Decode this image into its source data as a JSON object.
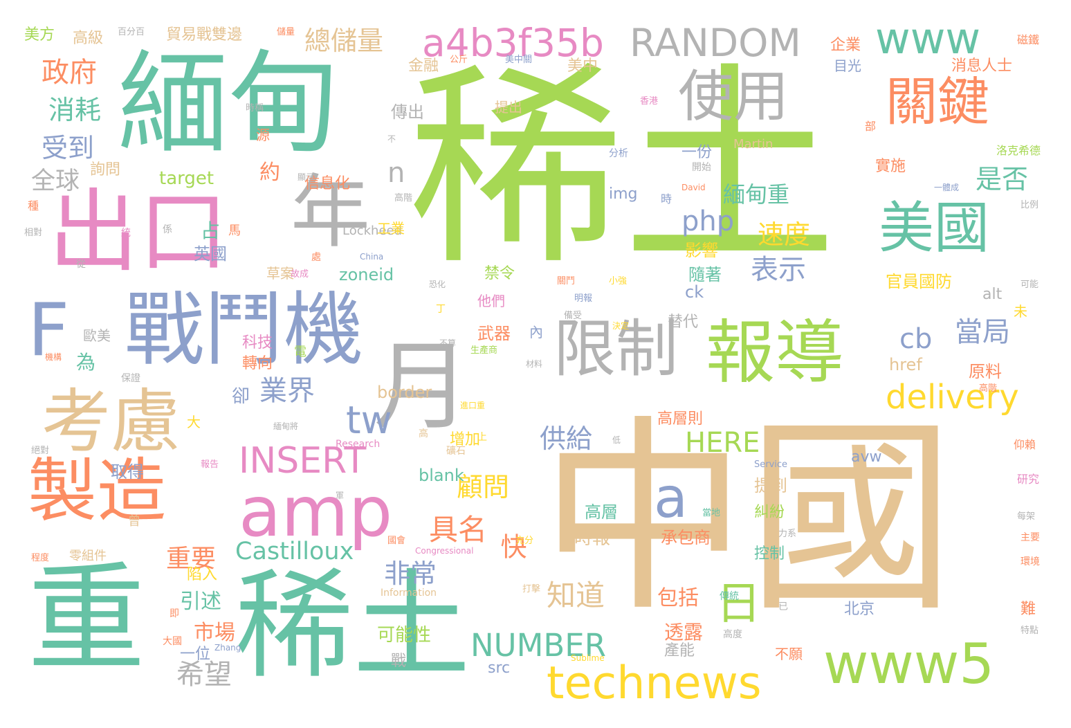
{
  "palette": {
    "green": "#a6d854",
    "teal": "#66c2a5",
    "orange": "#fc8d62",
    "blue": "#8da0cb",
    "pink": "#e78ac3",
    "tan": "#e5c494",
    "yellow": "#ffd92f",
    "gray": "#b3b3b3"
  },
  "words": [
    {
      "text": "稀土",
      "color": "green"
    },
    {
      "text": "中國",
      "color": "tan"
    },
    {
      "text": "緬甸",
      "color": "teal"
    },
    {
      "text": "稀土",
      "color": "teal"
    },
    {
      "text": "重",
      "color": "teal"
    },
    {
      "text": "出口",
      "color": "pink"
    },
    {
      "text": "戰鬥機",
      "color": "blue"
    },
    {
      "text": "F",
      "color": "blue"
    },
    {
      "text": "月",
      "color": "gray"
    },
    {
      "text": "年",
      "color": "gray"
    },
    {
      "text": "考慮",
      "color": "tan"
    },
    {
      "text": "製造",
      "color": "orange"
    },
    {
      "text": "amp",
      "color": "pink"
    },
    {
      "text": "報導",
      "color": "green"
    },
    {
      "text": "限制",
      "color": "gray"
    },
    {
      "text": "使用",
      "color": "gray"
    },
    {
      "text": "關鍵",
      "color": "orange"
    },
    {
      "text": "美國",
      "color": "teal"
    },
    {
      "text": "www",
      "color": "teal"
    },
    {
      "text": "www5",
      "color": "green"
    },
    {
      "text": "technews",
      "color": "yellow"
    },
    {
      "text": "RANDOM",
      "color": "gray"
    },
    {
      "text": "a4b3f35b",
      "color": "pink"
    },
    {
      "text": "delivery",
      "color": "yellow"
    },
    {
      "text": "INSERT",
      "color": "pink"
    },
    {
      "text": "NUMBER",
      "color": "teal"
    },
    {
      "text": "Castilloux",
      "color": "teal"
    },
    {
      "text": "HERE",
      "color": "green"
    },
    {
      "text": "php",
      "color": "blue"
    },
    {
      "text": "tw",
      "color": "blue"
    },
    {
      "text": "cb",
      "color": "blue"
    },
    {
      "text": "a",
      "color": "blue"
    },
    {
      "text": "n",
      "color": "gray"
    },
    {
      "text": "日",
      "color": "green"
    },
    {
      "text": "政府",
      "color": "orange"
    },
    {
      "text": "消耗",
      "color": "teal"
    },
    {
      "text": "受到",
      "color": "blue"
    },
    {
      "text": "全球",
      "color": "gray"
    },
    {
      "text": "總儲量",
      "color": "tan"
    },
    {
      "text": "當局",
      "color": "blue"
    },
    {
      "text": "是否",
      "color": "teal"
    },
    {
      "text": "表示",
      "color": "blue"
    },
    {
      "text": "速度",
      "color": "yellow"
    },
    {
      "text": "緬甸重",
      "color": "teal"
    },
    {
      "text": "業界",
      "color": "blue"
    },
    {
      "text": "供給",
      "color": "blue"
    },
    {
      "text": "具名",
      "color": "orange"
    },
    {
      "text": "顧問",
      "color": "yellow"
    },
    {
      "text": "非常",
      "color": "blue"
    },
    {
      "text": "知道",
      "color": "tan"
    },
    {
      "text": "希望",
      "color": "gray"
    },
    {
      "text": "重要",
      "color": "orange"
    },
    {
      "text": "市場",
      "color": "orange"
    },
    {
      "text": "引述",
      "color": "teal"
    },
    {
      "text": "陷入",
      "color": "yellow"
    },
    {
      "text": "一位",
      "color": "blue"
    },
    {
      "text": "包括",
      "color": "orange"
    },
    {
      "text": "透露",
      "color": "orange"
    },
    {
      "text": "產能",
      "color": "gray"
    },
    {
      "text": "承包商",
      "color": "orange"
    },
    {
      "text": "時報",
      "color": "tan"
    },
    {
      "text": "高層",
      "color": "teal"
    },
    {
      "text": "高層則",
      "color": "orange"
    },
    {
      "text": "增加",
      "color": "yellow"
    },
    {
      "text": "取得",
      "color": "blue"
    },
    {
      "text": "提到",
      "color": "tan"
    },
    {
      "text": "糾紛",
      "color": "green"
    },
    {
      "text": "控制",
      "color": "teal"
    },
    {
      "text": "北京",
      "color": "blue"
    },
    {
      "text": "可能性",
      "color": "green"
    },
    {
      "text": "src",
      "color": "blue"
    },
    {
      "text": "blank",
      "color": "teal"
    },
    {
      "text": "avw",
      "color": "blue"
    },
    {
      "text": "border",
      "color": "tan"
    },
    {
      "text": "href",
      "color": "tan"
    },
    {
      "text": "zoneid",
      "color": "teal"
    },
    {
      "text": "ck",
      "color": "blue"
    },
    {
      "text": "img",
      "color": "blue"
    },
    {
      "text": "target",
      "color": "green"
    },
    {
      "text": "alt",
      "color": "gray"
    },
    {
      "text": "Martin",
      "color": "tan"
    },
    {
      "text": "Lockheed",
      "color": "gray"
    },
    {
      "text": "Research",
      "color": "pink"
    },
    {
      "text": "Information",
      "color": "tan"
    },
    {
      "text": "Service",
      "color": "blue"
    },
    {
      "text": "Sublime",
      "color": "yellow"
    },
    {
      "text": "Zhang",
      "color": "blue"
    },
    {
      "text": "David",
      "color": "orange"
    },
    {
      "text": "China",
      "color": "blue"
    },
    {
      "text": "Congressional",
      "color": "pink"
    },
    {
      "text": "英國",
      "color": "blue"
    },
    {
      "text": "占",
      "color": "teal"
    },
    {
      "text": "馬",
      "color": "orange"
    },
    {
      "text": "武器",
      "color": "orange"
    },
    {
      "text": "禁令",
      "color": "green"
    },
    {
      "text": "他們",
      "color": "pink"
    },
    {
      "text": "科技",
      "color": "pink"
    },
    {
      "text": "轉向",
      "color": "orange"
    },
    {
      "text": "為",
      "color": "teal"
    },
    {
      "text": "卻",
      "color": "blue"
    },
    {
      "text": "快",
      "color": "orange"
    },
    {
      "text": "約",
      "color": "orange"
    },
    {
      "text": "草案",
      "color": "tan"
    },
    {
      "text": "影響",
      "color": "yellow"
    },
    {
      "text": "隨著",
      "color": "teal"
    },
    {
      "text": "替代",
      "color": "gray"
    },
    {
      "text": "傳出",
      "color": "gray"
    },
    {
      "text": "提出",
      "color": "tan"
    },
    {
      "text": "目光",
      "color": "blue"
    },
    {
      "text": "美中",
      "color": "tan"
    },
    {
      "text": "金融",
      "color": "tan"
    },
    {
      "text": "企業",
      "color": "orange"
    },
    {
      "text": "消息人士",
      "color": "orange"
    },
    {
      "text": "官員國防",
      "color": "yellow"
    },
    {
      "text": "實施",
      "color": "orange"
    },
    {
      "text": "原料",
      "color": "orange"
    },
    {
      "text": "工業",
      "color": "yellow"
    },
    {
      "text": "信息化",
      "color": "orange"
    },
    {
      "text": "詢問",
      "color": "tan"
    },
    {
      "text": "歐美",
      "color": "gray"
    },
    {
      "text": "美方",
      "color": "green"
    },
    {
      "text": "高級",
      "color": "tan"
    },
    {
      "text": "貿易戰雙邊",
      "color": "tan"
    },
    {
      "text": "百分百",
      "color": "gray"
    },
    {
      "text": "儲量",
      "color": "orange"
    },
    {
      "text": "磁鐵",
      "color": "orange"
    },
    {
      "text": "洛克希德",
      "color": "green"
    },
    {
      "text": "一份",
      "color": "blue"
    },
    {
      "text": "部",
      "color": "orange"
    },
    {
      "text": "時",
      "color": "blue"
    },
    {
      "text": "無法",
      "color": "green"
    },
    {
      "text": "開始",
      "color": "gray"
    },
    {
      "text": "比例",
      "color": "gray"
    },
    {
      "text": "一體成",
      "color": "blue"
    },
    {
      "text": "分析",
      "color": "blue"
    },
    {
      "text": "香港",
      "color": "pink"
    },
    {
      "text": "美中關",
      "color": "blue"
    },
    {
      "text": "公斤",
      "color": "orange"
    },
    {
      "text": "戰",
      "color": "gray"
    },
    {
      "text": "不願",
      "color": "orange"
    },
    {
      "text": "難",
      "color": "orange"
    },
    {
      "text": "未",
      "color": "yellow"
    },
    {
      "text": "內",
      "color": "blue"
    },
    {
      "text": "源",
      "color": "orange"
    },
    {
      "text": "不",
      "color": "gray"
    },
    {
      "text": "顯示",
      "color": "gray"
    },
    {
      "text": "高階",
      "color": "gray"
    },
    {
      "text": "種",
      "color": "orange"
    },
    {
      "text": "相對",
      "color": "gray"
    },
    {
      "text": "從",
      "color": "gray"
    },
    {
      "text": "統",
      "color": "pink"
    },
    {
      "text": "係",
      "color": "gray"
    },
    {
      "text": "處",
      "color": "orange"
    },
    {
      "text": "電",
      "color": "green"
    },
    {
      "text": "丁",
      "color": "yellow"
    },
    {
      "text": "不算",
      "color": "gray"
    },
    {
      "text": "機構",
      "color": "orange"
    },
    {
      "text": "保證",
      "color": "gray"
    },
    {
      "text": "上",
      "color": "yellow"
    },
    {
      "text": "高",
      "color": "tan"
    },
    {
      "text": "低",
      "color": "gray"
    },
    {
      "text": "大",
      "color": "yellow"
    },
    {
      "text": "報告",
      "color": "pink"
    },
    {
      "text": "軍",
      "color": "gray"
    },
    {
      "text": "曾",
      "color": "tan"
    },
    {
      "text": "程度",
      "color": "orange"
    },
    {
      "text": "零組件",
      "color": "tan"
    },
    {
      "text": "國會",
      "color": "orange"
    },
    {
      "text": "充分",
      "color": "yellow"
    },
    {
      "text": "打擊",
      "color": "tan"
    },
    {
      "text": "即",
      "color": "orange"
    },
    {
      "text": "大國",
      "color": "orange"
    },
    {
      "text": "已",
      "color": "gray"
    },
    {
      "text": "力系",
      "color": "gray"
    },
    {
      "text": "高度",
      "color": "gray"
    },
    {
      "text": "傳統",
      "color": "teal"
    },
    {
      "text": "當地",
      "color": "teal"
    },
    {
      "text": "特點",
      "color": "gray"
    },
    {
      "text": "研究",
      "color": "pink"
    },
    {
      "text": "仰賴",
      "color": "orange"
    },
    {
      "text": "主要",
      "color": "orange"
    },
    {
      "text": "環境",
      "color": "orange"
    },
    {
      "text": "每架",
      "color": "gray"
    },
    {
      "text": "可能",
      "color": "gray"
    },
    {
      "text": "絕對",
      "color": "gray"
    },
    {
      "text": "決定",
      "color": "yellow"
    },
    {
      "text": "小強",
      "color": "yellow"
    },
    {
      "text": "明報",
      "color": "blue"
    },
    {
      "text": "備受",
      "color": "gray"
    },
    {
      "text": "關鬥",
      "color": "orange"
    },
    {
      "text": "生產商",
      "color": "green"
    },
    {
      "text": "材料",
      "color": "gray"
    },
    {
      "text": "進口重",
      "color": "yellow"
    },
    {
      "text": "礦石",
      "color": "tan"
    },
    {
      "text": "緬甸將",
      "color": "gray"
    },
    {
      "text": "高階",
      "color": "orange"
    },
    {
      "text": "恐化",
      "color": "gray"
    },
    {
      "text": "故成",
      "color": "pink"
    },
    {
      "text": "時稱",
      "color": "gray"
    }
  ]
}
